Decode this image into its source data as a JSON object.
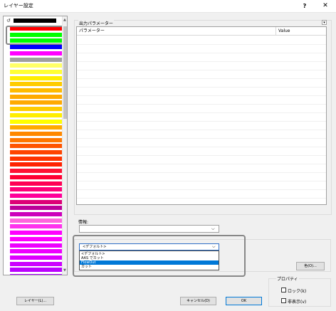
{
  "window": {
    "title": "レイヤー設定",
    "help_label": "?",
    "close_label": "✕"
  },
  "swatches": {
    "colors": [
      "#ff0000",
      "#00ff00",
      "#00ff00",
      "#0000ff",
      "#ff00ff",
      "#9e9e9e",
      "#ffff66",
      "#ffff33",
      "#ffee00",
      "#ffcc00",
      "#ffbb00",
      "#ffaa00",
      "#ffaa00",
      "#ffcc00",
      "#ffee00",
      "#ffff00",
      "#ffaa00",
      "#ff8800",
      "#ff7700",
      "#ff5500",
      "#ff4400",
      "#ff3300",
      "#ff2200",
      "#ff1133",
      "#ff0033",
      "#ff0055",
      "#ff0077",
      "#ff0099",
      "#dd0077",
      "#bb0099",
      "#cc00bb",
      "#ff66dd",
      "#ff33ee",
      "#ff00ff",
      "#ff00ff",
      "#ee00ff",
      "#ee00ff",
      "#dd00ff",
      "#cc00ff",
      "#bb00ff",
      "#aa00ff"
    ]
  },
  "params": {
    "group_label": "出力パラメーター",
    "expand_icon": "▾",
    "col_param": "パラメーター",
    "col_value": "Value"
  },
  "info": {
    "label": "情報:",
    "arrow": "⌵"
  },
  "mode": {
    "selected": "<デフォルト>",
    "arrow": "⌵",
    "options": [
      {
        "label": "<デフォルト>",
        "selected": false
      },
      {
        "label": "AAS でカット",
        "selected": false
      },
      {
        "label": "FlowOut",
        "selected": true
      },
      {
        "label": "カット",
        "selected": false
      }
    ]
  },
  "color_button": {
    "label": "色(O)..."
  },
  "properties": {
    "label": "プロパティ",
    "lock_label": "ロック(k)",
    "hide_label": "非表示(v)"
  },
  "footer": {
    "layer_label": "レイヤー(L)...",
    "cancel_label": "キャンセル(D)",
    "ok_label": "OK"
  },
  "colors": {
    "accent": "#0078d7",
    "highlight_border": "#888888"
  }
}
